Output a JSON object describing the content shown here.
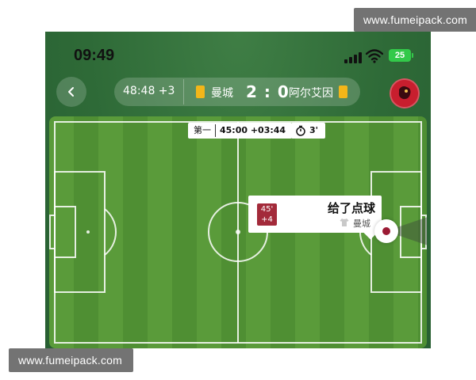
{
  "watermarks": {
    "top": "www.fumeipack.com",
    "bottom": "www.fumeipack.com"
  },
  "status_bar": {
    "time": "09:49",
    "battery": "25"
  },
  "header": {
    "back_icon": "chevron-left-icon",
    "match_clock": "48:48 +3",
    "home_team": "曼城",
    "score": "2 : 0",
    "away_team": "阿尔艾因",
    "card_color": "#f3b619",
    "avatar_icon": "team-logo-icon"
  },
  "pitch": {
    "period_label": "第一",
    "period_time": "45:00 +03:44",
    "timer_icon": "stopwatch-icon",
    "timer_value": "3'"
  },
  "event": {
    "minute_main": "45'",
    "minute_extra": "+4",
    "title": "给了点球",
    "team": "曼城",
    "shirt_icon": "shirt-icon",
    "accent_color": "#9b1a34"
  }
}
